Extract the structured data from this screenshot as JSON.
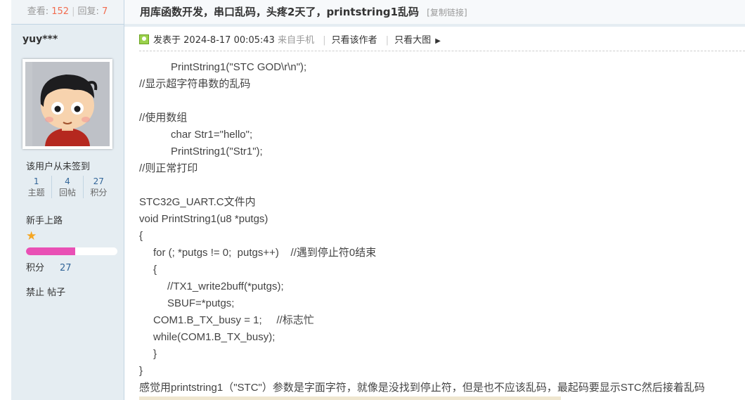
{
  "sidebar": {
    "views_label": "查看:",
    "views_count": "152",
    "replies_label": "回复:",
    "replies_count": "7",
    "username": "yuy***",
    "signin_status": "该用户从未签到",
    "stats": [
      {
        "value": "1",
        "label": "主题"
      },
      {
        "value": "4",
        "label": "回帖"
      },
      {
        "value": "27",
        "label": "积分"
      }
    ],
    "rank": "新手上路",
    "rank_stars": 1,
    "credit_progress_fraction": 0.54,
    "credits_label": "积分",
    "credits_value": "27",
    "status": "禁止 帖子"
  },
  "thread": {
    "title": "用库函数开发，串口乱码，头疼2天了，printstring1乱码",
    "copy_link": "[复制链接]"
  },
  "post": {
    "posted_prefix": "发表于",
    "posted_time": "2024-8-17 00:05:43",
    "source": "来自手机",
    "only_author": "只看该作者",
    "only_large_images": "只看大图",
    "lines": {
      "l1": "PrintString1(\"STC GOD\\r\\n\");",
      "l2": "//显示超字符串数的乱码",
      "l3": "//使用数组",
      "l4": "char Str1=\"hello\";",
      "l5": "PrintString1(\"Str1\");",
      "l6": "//则正常打印",
      "l7": "STC32G_UART.C文件内",
      "l8": "void PrintString1(u8 *putgs)",
      "l9": "{",
      "l10": "for (; *putgs != 0;  putgs++)    //遇到停止符0结束",
      "l11": "{",
      "l12": "//TX1_write2buff(*putgs);",
      "l13": "SBUF=*putgs;",
      "l14": "COM1.B_TX_busy = 1;     //标志忙",
      "l15": "while(COM1.B_TX_busy);",
      "l16": "}",
      "l17": "}",
      "l18": "感觉用printstring1（\"STC\"）参数是字面字符，就像是没找到停止符，但是也不应该乱码，最起码要显示STC然后接着乱码"
    }
  }
}
